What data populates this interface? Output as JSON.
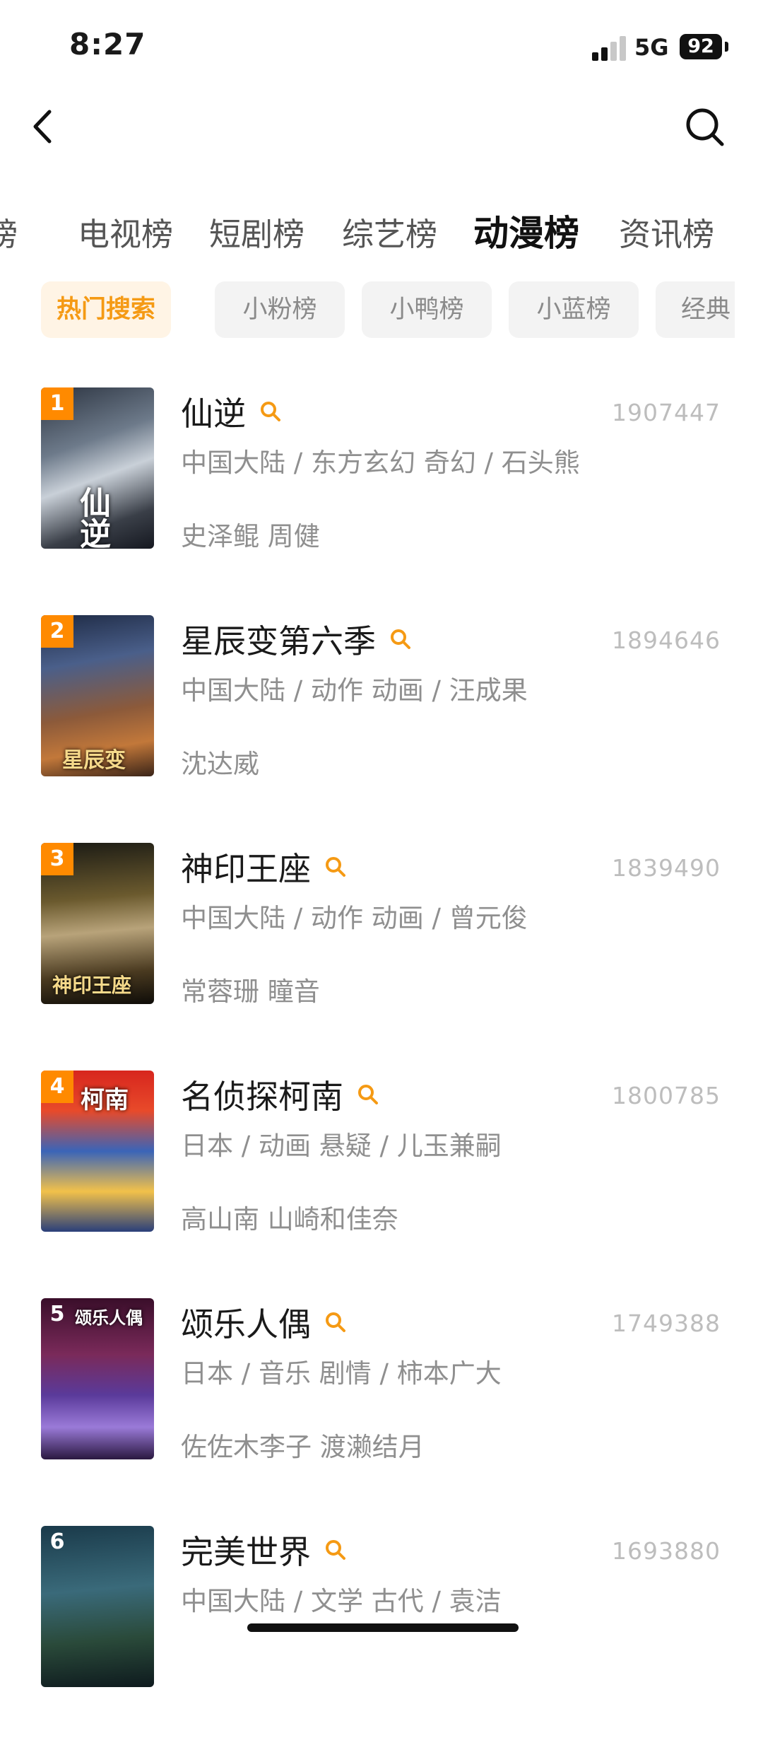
{
  "status_bar": {
    "time": "8:27",
    "network": "5G",
    "battery": "92"
  },
  "header": {
    "back_icon": "chevron-left-icon",
    "search_icon": "search-icon"
  },
  "tabs": [
    {
      "label": "榜",
      "active": false
    },
    {
      "label": "电视榜",
      "active": false
    },
    {
      "label": "短剧榜",
      "active": false
    },
    {
      "label": "综艺榜",
      "active": false
    },
    {
      "label": "动漫榜",
      "active": true
    },
    {
      "label": "资讯榜",
      "active": false
    }
  ],
  "subtabs": [
    {
      "label": "热门搜索",
      "active": true
    },
    {
      "label": "小粉榜",
      "active": false
    },
    {
      "label": "小鸭榜",
      "active": false
    },
    {
      "label": "小蓝榜",
      "active": false
    },
    {
      "label": "经典",
      "active": false
    }
  ],
  "colors": {
    "accent": "#f59a14",
    "accent_bg": "#fff4e5",
    "badge": "#ff8a00"
  },
  "items": [
    {
      "rank": "1",
      "title": "仙逆",
      "heat": "1907447",
      "meta": "中国大陆 / 东方玄幻 奇幻 / 石头熊",
      "cast": "史泽鲲 周健",
      "poster_text": "仙逆"
    },
    {
      "rank": "2",
      "title": "星辰变第六季",
      "heat": "1894646",
      "meta": "中国大陆 / 动作 动画 / 汪成果",
      "cast": "沈达威",
      "poster_text": "星辰变"
    },
    {
      "rank": "3",
      "title": "神印王座",
      "heat": "1839490",
      "meta": "中国大陆 / 动作 动画 / 曾元俊",
      "cast": "常蓉珊 瞳音",
      "poster_text": "神印王座"
    },
    {
      "rank": "4",
      "title": "名侦探柯南",
      "heat": "1800785",
      "meta": "日本 / 动画 悬疑 / 儿玉兼嗣",
      "cast": "高山南 山崎和佳奈",
      "poster_text": "柯南"
    },
    {
      "rank": "5",
      "title": "颂乐人偶",
      "heat": "1749388",
      "meta": "日本 / 音乐 剧情 / 柿本广大",
      "cast": "佐佐木李子 渡濑结月",
      "poster_text": "颂乐人偶"
    },
    {
      "rank": "6",
      "title": "完美世界",
      "heat": "1693880",
      "meta": "中国大陆 / 文学 古代 / 袁洁",
      "cast": "",
      "poster_text": ""
    }
  ]
}
